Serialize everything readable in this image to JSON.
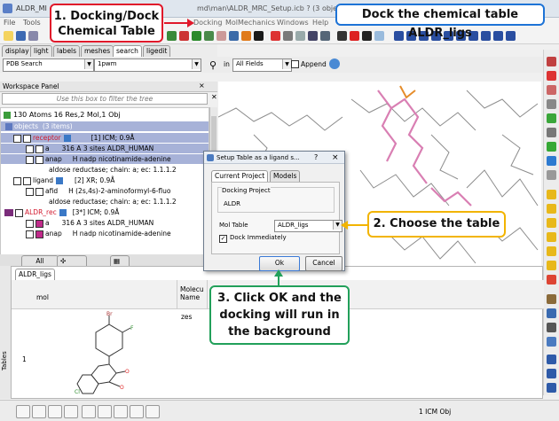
{
  "window": {
    "title_left": "ALDR_MI",
    "title_mid": "md\\man\\ALDR_MRC_Setup.icb ? (3 objects 1 table)"
  },
  "menu": {
    "file": "File",
    "tools": "Tools",
    "docking": "Docking",
    "molmechanics": "MolMechanics",
    "windows": "Windows",
    "help": "Help"
  },
  "left_tabs": [
    "display",
    "light",
    "labels",
    "meshes",
    "search",
    "ligedit"
  ],
  "search": {
    "source": "PDB Search",
    "query": "1pwm",
    "in_label": "in",
    "field": "All Fields",
    "append_label": "Append"
  },
  "workspace": {
    "title": "Workspace Panel",
    "filter_placeholder": "Use this box to filter the tree",
    "summary": "130 Atoms 16 Res,2 Mol,1 Obj",
    "rows": [
      {
        "name": "objects",
        "info": "(3 items)"
      },
      {
        "name": "receptor",
        "info": "[1] ICM; 0.9Å"
      },
      {
        "name": "a",
        "info": "316 A  3 sites ALDR_HUMAN"
      },
      {
        "name": "anap",
        "info": "H  nadp nicotinamide-adenine"
      },
      {
        "name": "aldose reductase; chain: a; ec: 1.1.1.2",
        "info": ""
      },
      {
        "name": "ligand",
        "info": "[2] XR; 0.9Å"
      },
      {
        "name": "afid",
        "info": "H  (2s,4s)-2-aminoformyl-6-fluo"
      },
      {
        "name": "aldose reductase; chain: a; ec: 1.1.1.2",
        "info": ""
      },
      {
        "name": "ALDR_rec",
        "info": "[3*] ICM; 0.9Å"
      },
      {
        "name": "a",
        "info": "316 A  3 sites ALDR_HUMAN"
      },
      {
        "name": "anap",
        "info": "H  nadp nicotinamide-adenine"
      }
    ]
  },
  "bottom_tabs": {
    "all": "All"
  },
  "table": {
    "tab_label": "ALDR_ligs",
    "col_mol": "mol",
    "col_molecule": "Molecu\nName",
    "row_number": "1",
    "molecule_name_partial": "zes",
    "side_label": "Tables"
  },
  "dialog": {
    "title": "Setup Table as a ligand s...",
    "help": "?",
    "tabs": [
      "Current Project",
      "Models"
    ],
    "group_label": "Docking Project",
    "project_name": "ALDR",
    "mol_table_label": "Mol Table",
    "mol_table_value": "ALDR_ligs",
    "dock_immediately_label": "Dock Immediately",
    "dock_immediately_checked": true,
    "ok_label": "Ok",
    "cancel_label": "Cancel"
  },
  "status": {
    "obj_count": "1 ICM Obj"
  },
  "callouts": {
    "step1": "1. Docking/Dock\nChemical Table",
    "top": "Dock the chemical table ALDR_ligs",
    "step2": "2. Choose the table",
    "step3": "3. Click OK and the\ndocking will run in\nthe background"
  },
  "colors": {
    "red": "#e0182a",
    "blue": "#1d73d6",
    "yellow": "#f2b400",
    "green": "#22a05a",
    "selection": "#a7b2d8",
    "receptor_red": "#d2192e"
  }
}
